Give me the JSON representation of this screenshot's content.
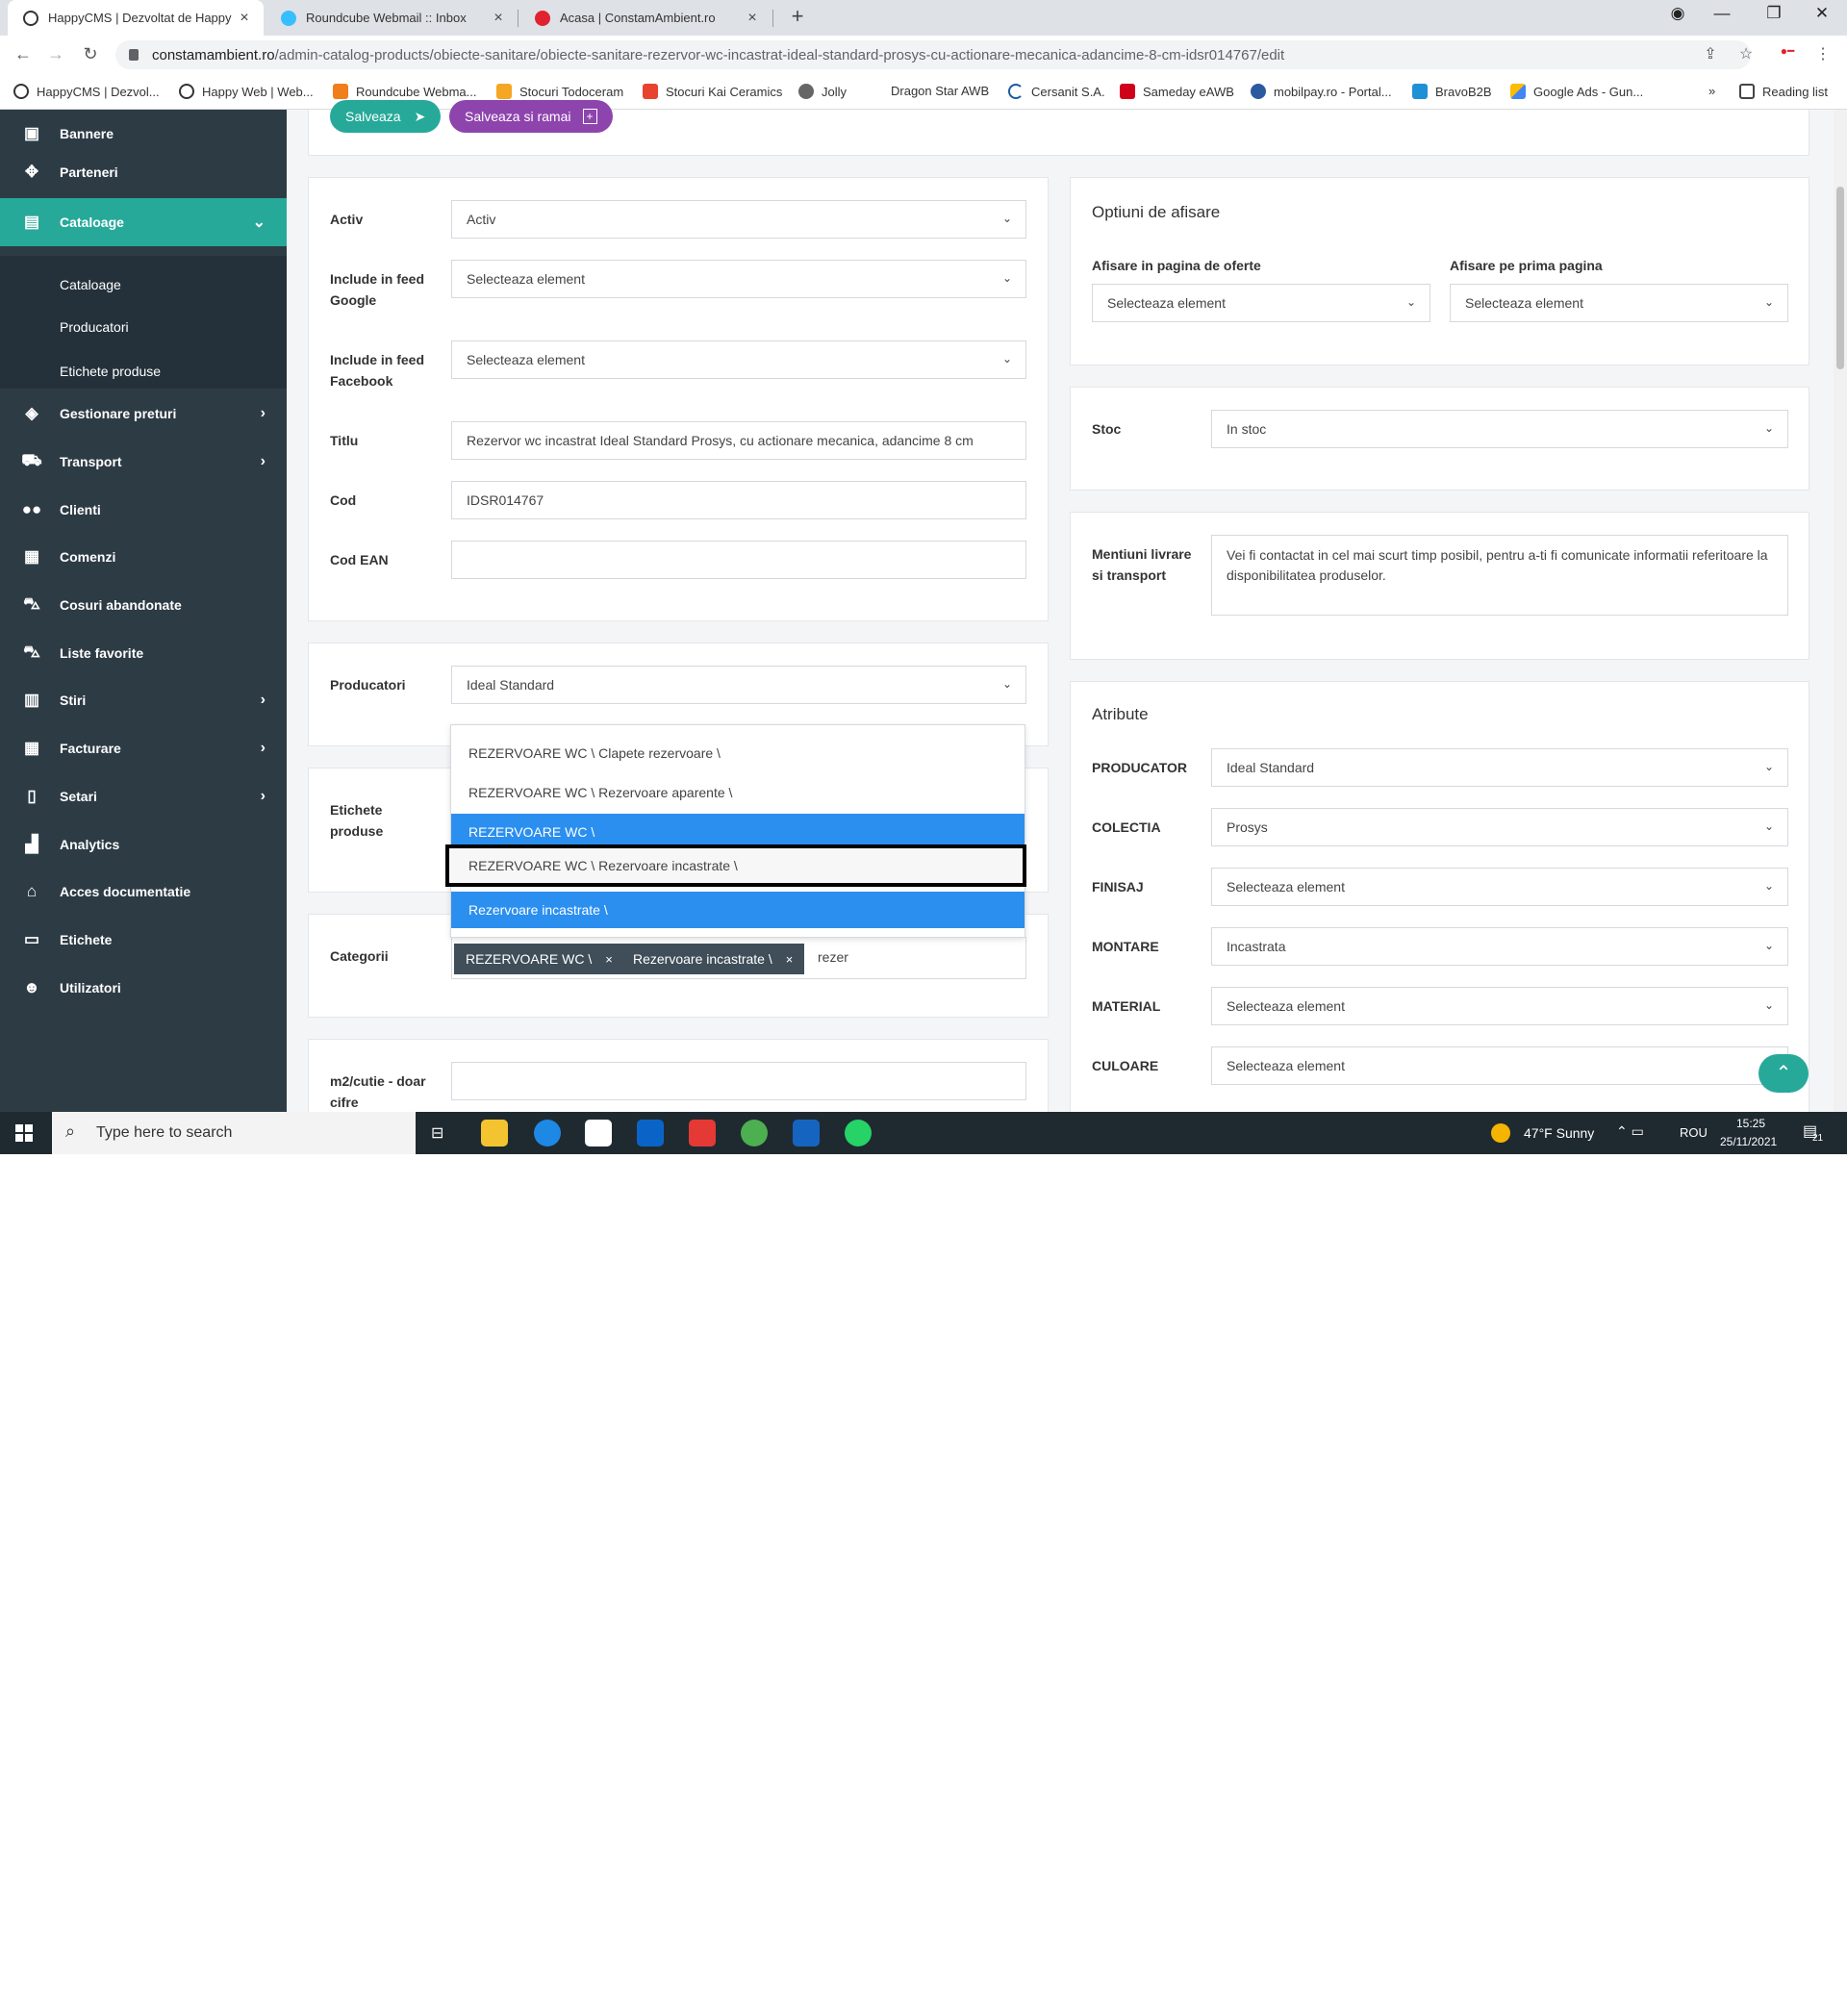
{
  "browser": {
    "tabs": [
      {
        "title": "HappyCMS | Dezvoltat de Happy",
        "active": true
      },
      {
        "title": "Roundcube Webmail :: Inbox",
        "active": false
      },
      {
        "title": "Acasa | ConstamAmbient.ro",
        "active": false
      }
    ],
    "close_glyph": "×",
    "new_tab_glyph": "+",
    "url_host": "constamambient.ro",
    "url_path": "/admin-catalog-products/obiecte-sanitare/obiecte-sanitare-rezervor-wc-incastrat-ideal-standard-prosys-cu-actionare-mecanica-adancime-8-cm-idsr014767/edit",
    "bookmarks": [
      "HappyCMS | Dezvol...",
      "Happy Web | Web...",
      "Roundcube Webma...",
      "Stocuri Todoceram",
      "Stocuri Kai Ceramics",
      "Jolly",
      "Dragon Star AWB",
      "Cersanit S.A.",
      "Sameday eAWB",
      "mobilpay.ro - Portal...",
      "BravoB2B",
      "Google Ads - Gun..."
    ],
    "bookmarks_more": "»",
    "reading_list": "Reading list"
  },
  "sidebar": {
    "items": [
      {
        "label": "Bannere",
        "icon": "image-icon"
      },
      {
        "label": "Parteneri",
        "icon": "handshake-icon"
      },
      {
        "label": "Cataloage",
        "icon": "catalog-icon"
      },
      {
        "label": "Gestionare preturi",
        "icon": "tag-icon"
      },
      {
        "label": "Transport",
        "icon": "truck-icon"
      },
      {
        "label": "Clienti",
        "icon": "users-icon"
      },
      {
        "label": "Comenzi",
        "icon": "cash-register-icon"
      },
      {
        "label": "Cosuri abandonate",
        "icon": "cart-icon"
      },
      {
        "label": "Liste favorite",
        "icon": "cart-arrow-icon"
      },
      {
        "label": "Stiri",
        "icon": "newspaper-icon"
      },
      {
        "label": "Facturare",
        "icon": "invoice-icon"
      },
      {
        "label": "Setari",
        "icon": "settings-icon"
      },
      {
        "label": "Analytics",
        "icon": "chart-icon"
      },
      {
        "label": "Acces documentatie",
        "icon": "home-icon"
      },
      {
        "label": "Etichete",
        "icon": "book-icon"
      },
      {
        "label": "Utilizatori",
        "icon": "user-icon"
      }
    ],
    "submenu": [
      "Cataloage",
      "Producatori",
      "Etichete produse"
    ],
    "accent_color": "#27a99a",
    "bg_color": "#2d3b45"
  },
  "toolbar": {
    "save_label": "Salveaza",
    "save_stay_label": "Salveaza si ramai"
  },
  "form": {
    "activ_label": "Activ",
    "activ_value": "Activ",
    "google_label": "Include in feed Google",
    "google_value": "Selecteaza element",
    "facebook_label": "Include in feed Facebook",
    "facebook_value": "Selecteaza element",
    "titlu_label": "Titlu",
    "titlu_value": "Rezervor wc incastrat Ideal Standard Prosys, cu actionare mecanica, adancime 8 cm",
    "cod_label": "Cod",
    "cod_value": "IDSR014767",
    "ean_label": "Cod EAN",
    "ean_value": "",
    "producatori_label": "Producatori",
    "producatori_value": "Ideal Standard",
    "etichete_label": "Etichete produse",
    "categorii_label": "Categorii",
    "categorii_chips": [
      "REZERVOARE WC \\",
      "Rezervoare incastrate \\"
    ],
    "categorii_search": "rezer",
    "chip_remove": "×",
    "m2_label": "m2/cutie - doar cifre",
    "m2_value": ""
  },
  "dropdown": {
    "options": [
      {
        "label": "REZERVOARE WC \\ Clapete rezervoare \\",
        "state": "normal"
      },
      {
        "label": "REZERVOARE WC \\ Rezervoare aparente \\",
        "state": "normal"
      },
      {
        "label": "REZERVOARE WC \\",
        "state": "selected"
      },
      {
        "label": "REZERVOARE WC \\ Rezervoare incastrate \\",
        "state": "focused"
      },
      {
        "label": "Rezervoare incastrate \\",
        "state": "selected"
      }
    ],
    "highlight_color": "#2b8ff0"
  },
  "display_options": {
    "title": "Optiuni de afisare",
    "oferte_label": "Afisare in pagina de oferte",
    "oferte_value": "Selecteaza element",
    "prima_label": "Afisare pe prima pagina",
    "prima_value": "Selecteaza element"
  },
  "stock": {
    "label": "Stoc",
    "value": "In stoc"
  },
  "delivery": {
    "label": "Mentiuni livrare si transport",
    "value": "Vei fi contactat in cel mai scurt timp posibil, pentru a-ti fi comunicate informatii referitoare la disponibilitatea produselor."
  },
  "attributes": {
    "title": "Atribute",
    "rows": [
      {
        "label": "PRODUCATOR",
        "value": "Ideal Standard"
      },
      {
        "label": "COLECTIA",
        "value": "Prosys"
      },
      {
        "label": "FINISAJ",
        "value": "Selecteaza element"
      },
      {
        "label": "MONTARE",
        "value": "Incastrata"
      },
      {
        "label": "MATERIAL",
        "value": "Selecteaza element"
      },
      {
        "label": "CULOARE",
        "value": "Selecteaza element"
      }
    ]
  },
  "taskbar": {
    "search_placeholder": "Type here to search",
    "weather": "47°F  Sunny",
    "lang": "ROU",
    "time": "15:25",
    "date": "25/11/2021",
    "notifications": "21"
  }
}
